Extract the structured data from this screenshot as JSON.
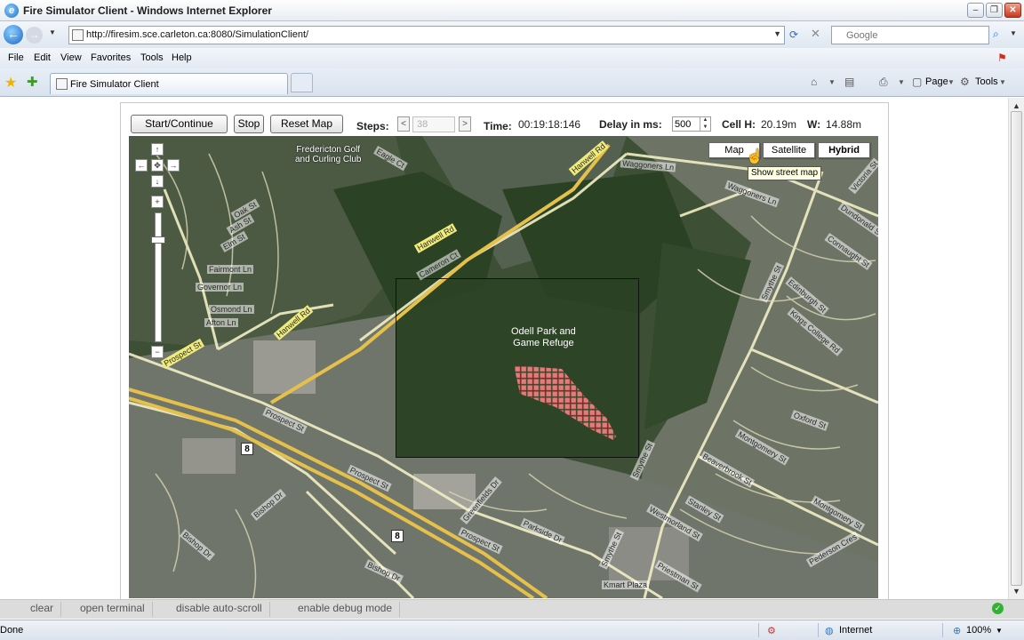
{
  "window": {
    "title": "Fire Simulator Client - Windows Internet Explorer",
    "app_icon": "internet-explorer-icon"
  },
  "address": {
    "url": "http://firesim.sce.carleton.ca:8080/SimulationClient/",
    "search_placeholder": "Google"
  },
  "menu": [
    "File",
    "Edit",
    "View",
    "Favorites",
    "Tools",
    "Help"
  ],
  "tab": {
    "title": "Fire Simulator Client"
  },
  "commandbar": {
    "page_label": "Page",
    "tools_label": "Tools"
  },
  "toolbar": {
    "start_label": "Start/Continue",
    "stop_label": "Stop",
    "reset_label": "Reset Map",
    "steps_label": "Steps:",
    "steps_prev": "<",
    "steps_value": "38",
    "steps_next": ">",
    "time_label": "Time:",
    "time_value": "00:19:18:146",
    "delay_label": "Delay in ms:",
    "delay_value": "500",
    "cell_h_label": "Cell H:",
    "cell_h_value": "20.19m",
    "cell_w_label": "W:",
    "cell_w_value": "14.88m"
  },
  "map": {
    "types": [
      "Map",
      "Satellite",
      "Hybrid"
    ],
    "selected_type": "Hybrid",
    "tooltip": "Show street map",
    "park_label_1": "Odell Park and",
    "park_label_2": "Game Refuge",
    "golf_label_1": "Fredericton Golf",
    "golf_label_2": "and Curling Club",
    "highway_shield": "8",
    "streets": {
      "hanwell_rd": "Hanwell Rd",
      "prospect_st": "Prospect St",
      "waggoners_ln": "Waggoners Ln",
      "smythe_st": "Smythe St",
      "bishop_dr": "Bishop Dr",
      "kmart_plaza": "Kmart Plaza",
      "governor_ln": "Governor Ln",
      "fairmont_ln": "Fairmont Ln",
      "osmond_ln": "Osmond Ln",
      "afton_ln": "Afton Ln",
      "elm_st": "Elm St",
      "ash_st": "Ash St",
      "oak_st": "Oak St",
      "connaught_st": "Connaught St",
      "dundonald_st": "Dundonald St",
      "victoria_st": "Victoria St",
      "edinburgh_st": "Edinburgh St",
      "kings_college_rd": "Kings College Rd",
      "oxford_st": "Oxford St",
      "montgomery_st": "Montgomery St",
      "beaverbrook_st": "Beaverbrook St",
      "stanley_st": "Stanley St",
      "westmorland_st": "Westmorland St",
      "priestman_st": "Priestman St",
      "pederson_cres": "Pederson Cres",
      "parkside_dr": "Parkside Dr",
      "greenfields_dr": "Greenfields Dr",
      "eagle_ct": "Eagle Ct",
      "cameron_ct": "Cameron Ct"
    }
  },
  "debug": [
    "clear",
    "open terminal",
    "disable auto-scroll",
    "enable debug mode"
  ],
  "status": {
    "left": "Done",
    "zone": "Internet",
    "zoom": "100%"
  },
  "colors": {
    "forest": "#2f4424",
    "road": "#f3f3a0",
    "fire_cell": "#e07c7c",
    "highway": "#e5c04a"
  }
}
